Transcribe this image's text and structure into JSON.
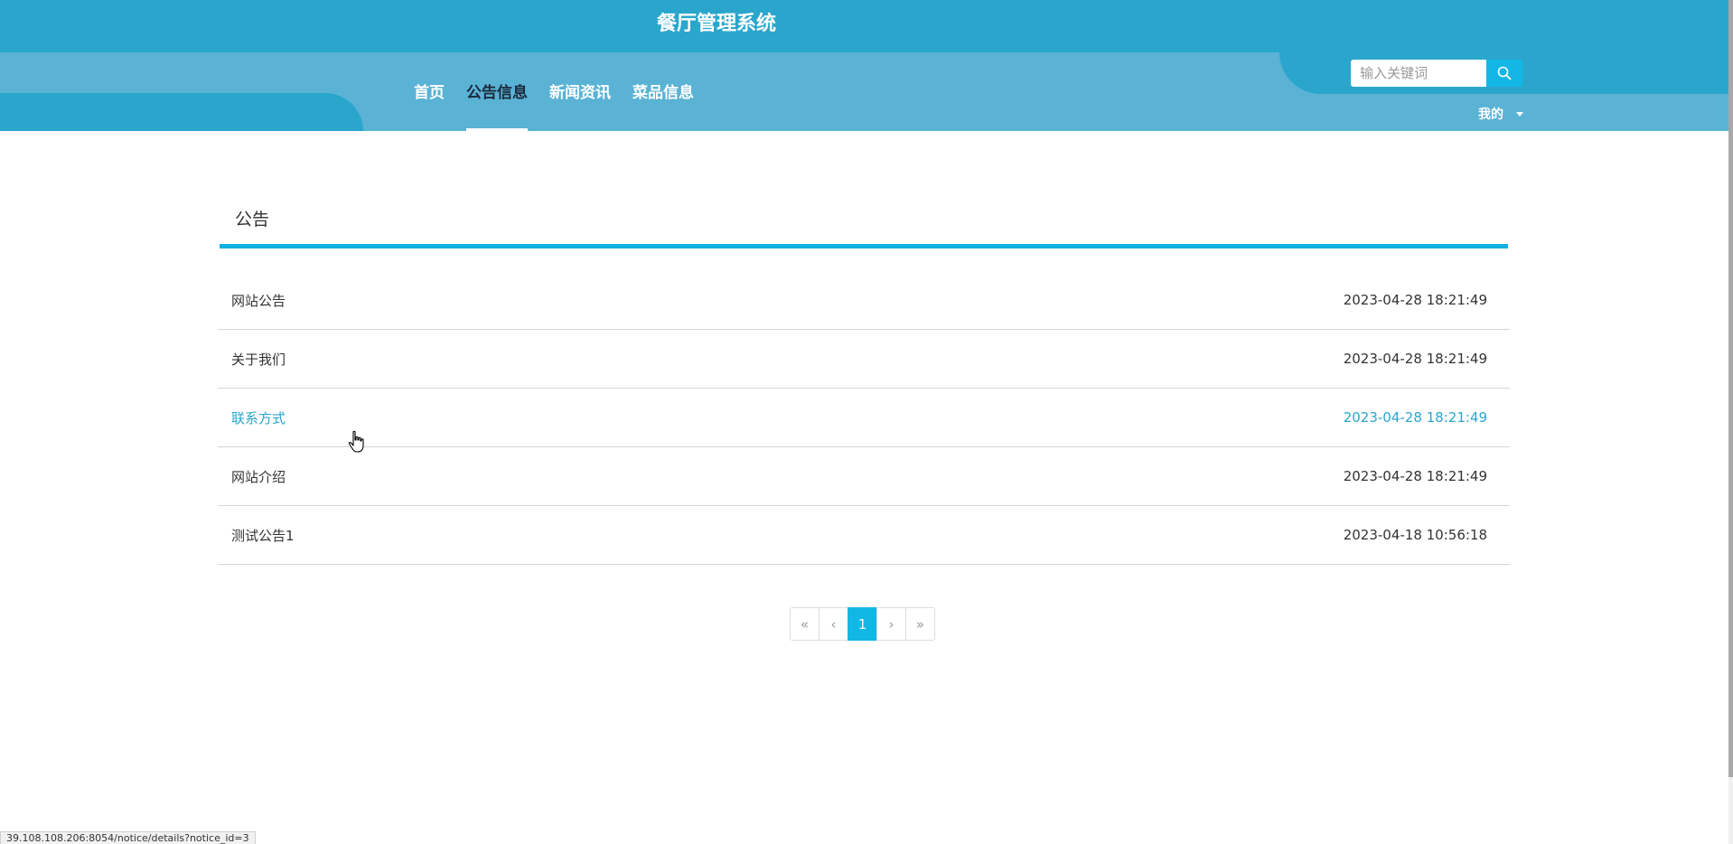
{
  "header": {
    "title": "餐厅管理系统",
    "nav": [
      {
        "label": "首页",
        "active": false
      },
      {
        "label": "公告信息",
        "active": true
      },
      {
        "label": "新闻资讯",
        "active": false
      },
      {
        "label": "菜品信息",
        "active": false
      }
    ],
    "search": {
      "placeholder": "输入关键词",
      "value": ""
    },
    "user_menu_label": "我的"
  },
  "section": {
    "title": "公告",
    "notices": [
      {
        "title": "网站公告",
        "time": "2023-04-28 18:21:49",
        "hover": false
      },
      {
        "title": "关于我们",
        "time": "2023-04-28 18:21:49",
        "hover": false
      },
      {
        "title": "联系方式",
        "time": "2023-04-28 18:21:49",
        "hover": true
      },
      {
        "title": "网站介绍",
        "time": "2023-04-28 18:21:49",
        "hover": false
      },
      {
        "title": "测试公告1",
        "time": "2023-04-18 10:56:18",
        "hover": false
      }
    ]
  },
  "pagination": {
    "first": "«",
    "prev": "‹",
    "current": "1",
    "next": "›",
    "last": "»"
  },
  "status_url": "39.108.108.206:8054/notice/details?notice_id=3",
  "colors": {
    "header_dark": "#2aa6cd",
    "header_light": "#5ab2d5",
    "accent": "#12b7e6",
    "hover_text": "#2aa6cd"
  }
}
